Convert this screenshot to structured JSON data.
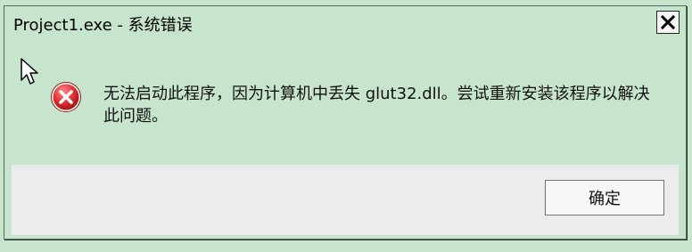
{
  "window": {
    "title": "Project1.exe - 系统错误"
  },
  "message": {
    "text": "无法启动此程序，因为计算机中丢失 glut32.dll。尝试重新安装该程序以解决此问题。"
  },
  "buttons": {
    "ok_label": "确定"
  },
  "icons": {
    "error": "error-icon",
    "close": "close-icon",
    "cursor": "mouse-pointer-icon"
  },
  "colors": {
    "dialog_background": "#c7e4cc",
    "button_panel": "#ececec",
    "error_red": "#d92b2b"
  }
}
